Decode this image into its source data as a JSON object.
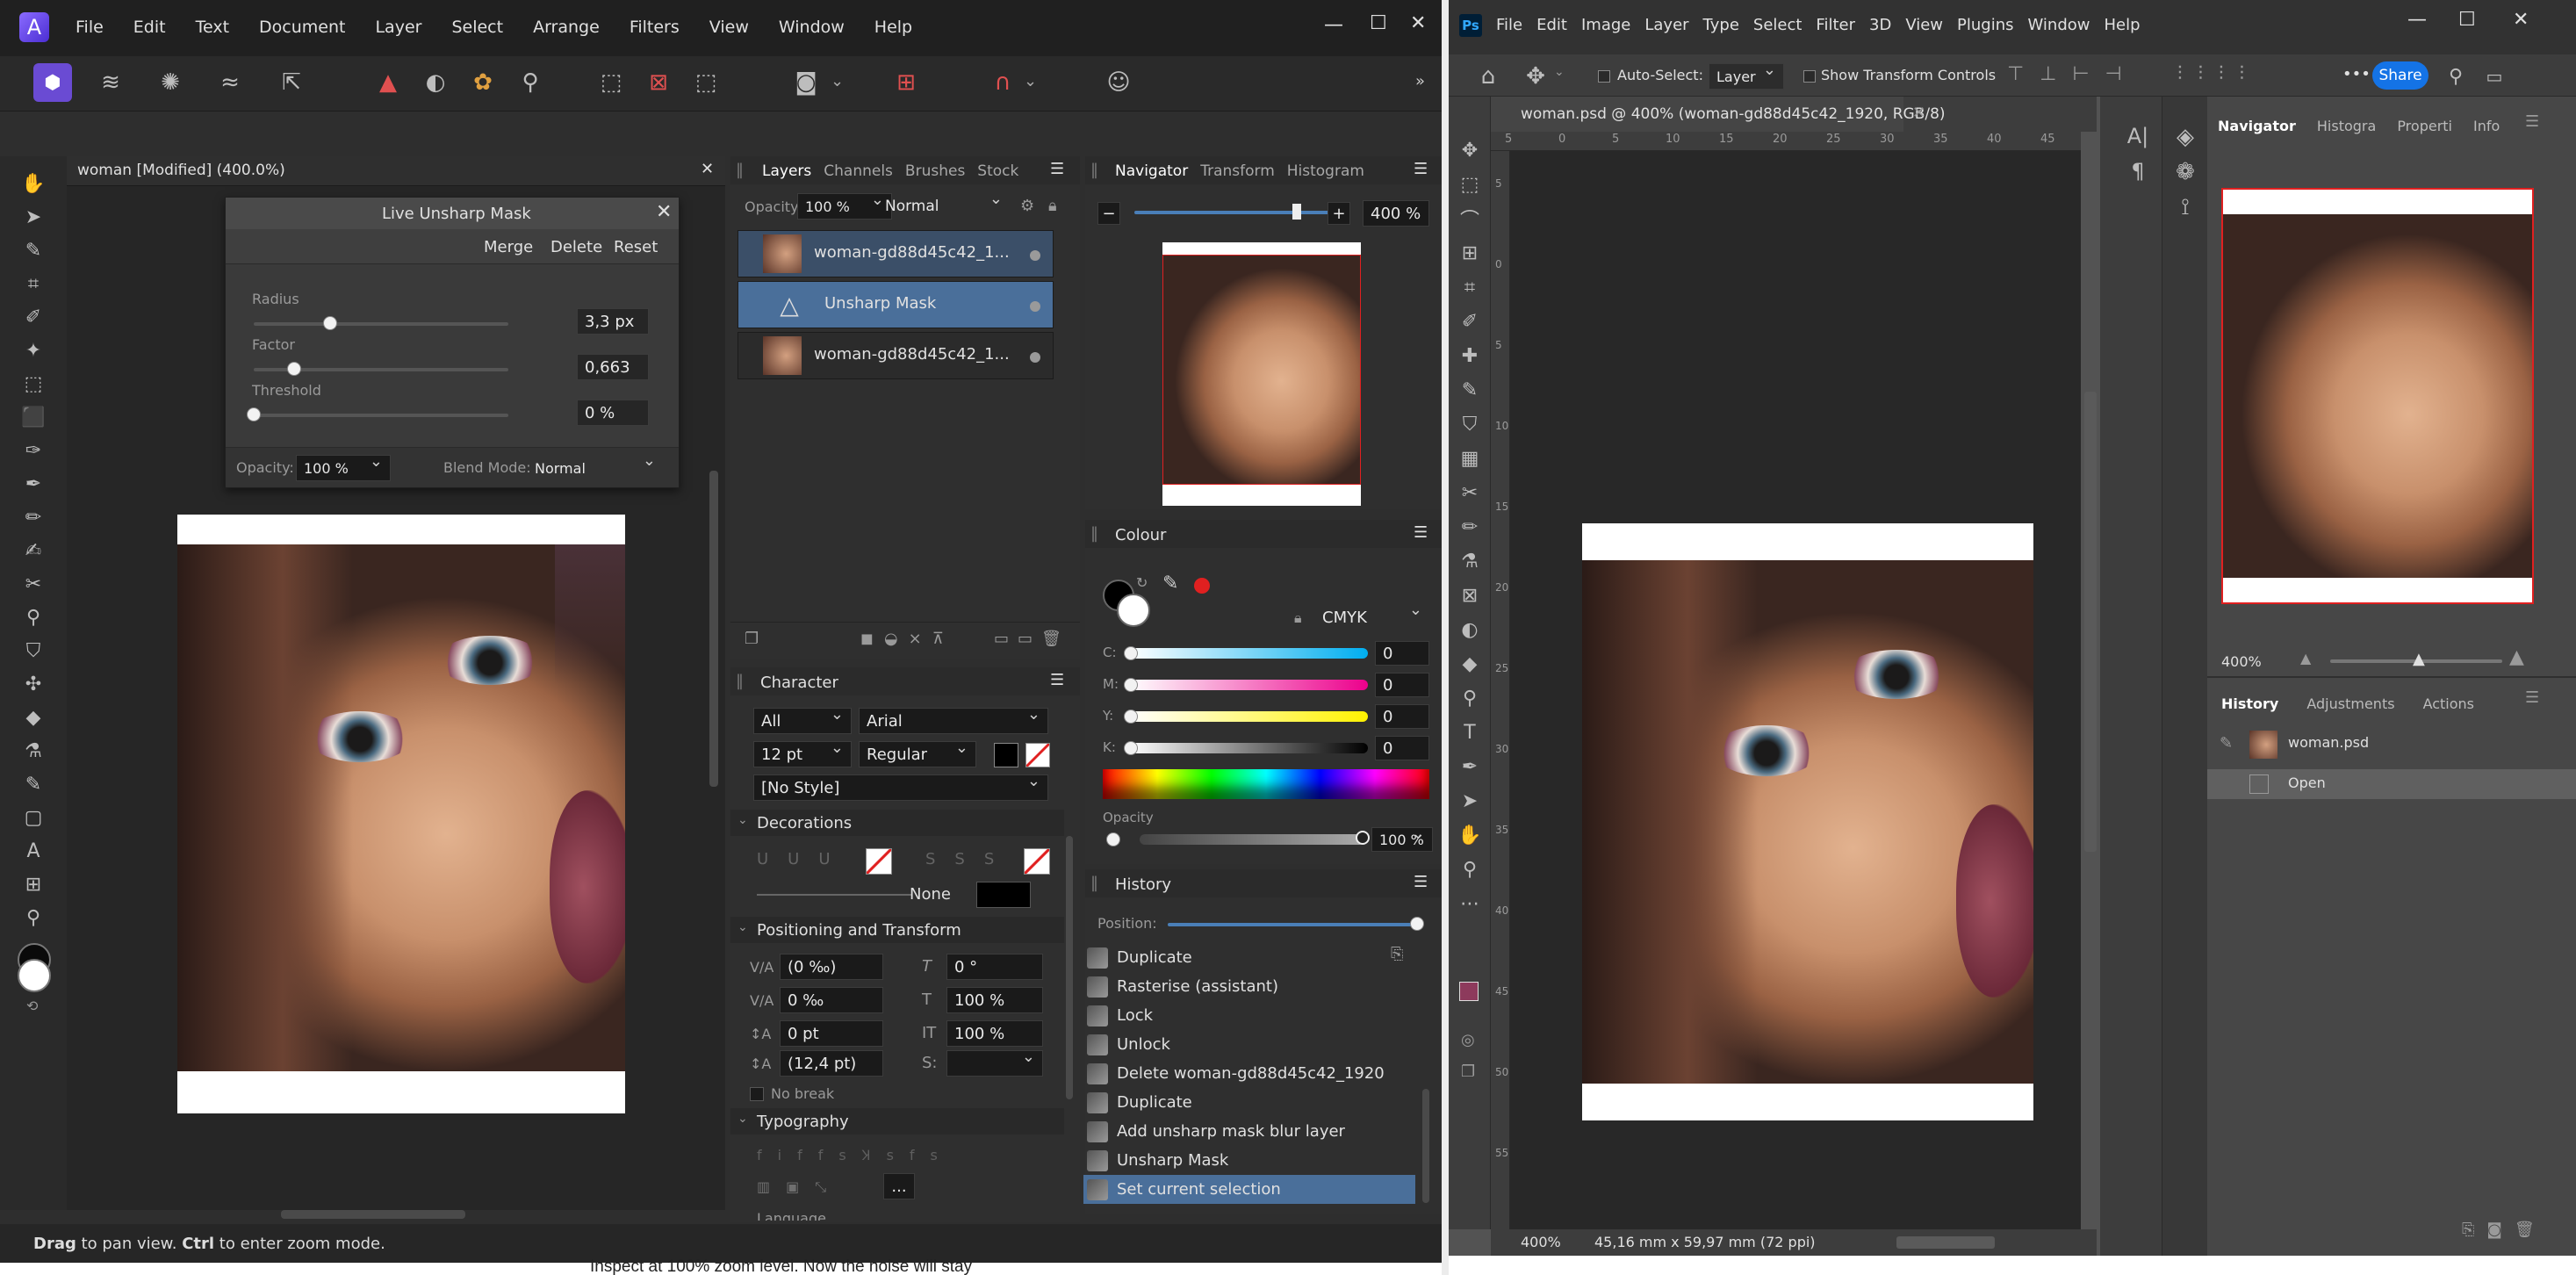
{
  "affinity": {
    "menu": [
      "File",
      "Edit",
      "Text",
      "Document",
      "Layer",
      "Select",
      "Arrange",
      "Filters",
      "View",
      "Window",
      "Help"
    ],
    "window_controls": {
      "minimize": "—",
      "maximize": "☐",
      "close": "✕"
    },
    "doc_tab": "woman [Modified] (400.0%)",
    "unsharp": {
      "title": "Live Unsharp Mask",
      "merge": "Merge",
      "delete": "Delete",
      "reset": "Reset",
      "radius_label": "Radius",
      "radius_value": "3,3 px",
      "radius_pos": 0.3,
      "factor_label": "Factor",
      "factor_value": "0,663",
      "factor_pos": 0.16,
      "threshold_label": "Threshold",
      "threshold_value": "0 %",
      "threshold_pos": 0.0,
      "opacity_label": "Opacity:",
      "opacity_value": "100 %",
      "blend_label": "Blend Mode:",
      "blend_value": "Normal"
    },
    "layers_panel": {
      "tabs": [
        "Layers",
        "Channels",
        "Brushes",
        "Stock"
      ],
      "opacity_label": "Opacity:",
      "opacity_value": "100 %",
      "blend": "Normal",
      "layers": [
        {
          "name": "woman-gd88d45c42_1..."
        },
        {
          "name": "Unsharp Mask"
        },
        {
          "name": "woman-gd88d45c42_1..."
        }
      ]
    },
    "navigator_panel": {
      "tabs": [
        "Navigator",
        "Transform",
        "Histogram"
      ],
      "zoom": "400 %",
      "zoom_minus": "−",
      "zoom_plus": "+"
    },
    "colour_panel": {
      "title": "Colour",
      "model": "CMYK",
      "c_label": "C:",
      "c": "0",
      "m_label": "M:",
      "m": "0",
      "y_label": "Y:",
      "y": "0",
      "k_label": "K:",
      "k": "0",
      "opacity_label": "Opacity",
      "opacity_value": "100 %"
    },
    "character_panel": {
      "title": "Character",
      "scope": "All",
      "font": "Arial",
      "size": "12 pt",
      "style": "Regular",
      "paragraph_style": "[No Style]",
      "decorations": "Decorations",
      "line_none": "None",
      "positioning": "Positioning and Transform",
      "tracking": "(0 ‰)",
      "shear": "0 °",
      "kerning": "0 ‰",
      "scale_h": "100 %",
      "baseline": "0 pt",
      "scale_v": "100 %",
      "leading": "(12,4 pt)",
      "no_break": "No break",
      "typography": "Typography",
      "language": "Language",
      "more": "..."
    },
    "history_panel": {
      "title": "History",
      "position_label": "Position:",
      "items": [
        "Duplicate",
        "Rasterise (assistant)",
        "Lock",
        "Unlock",
        "Delete woman-gd88d45c42_1920",
        "Duplicate",
        "Add unsharp mask blur layer",
        "Unsharp Mask",
        "Set current selection"
      ]
    },
    "status": {
      "bold1": "Drag",
      "text1": " to pan view. ",
      "bold2": "Ctrl",
      "text2": " to enter zoom mode."
    }
  },
  "photoshop": {
    "logo": "Ps",
    "menu": [
      "File",
      "Edit",
      "Image",
      "Layer",
      "Type",
      "Select",
      "Filter",
      "3D",
      "View",
      "Plugins",
      "Window",
      "Help"
    ],
    "options": {
      "auto_select": "Auto-Select:",
      "layer": "Layer",
      "show_transform": "Show Transform Controls",
      "more": "•••",
      "share": "Share"
    },
    "doc_tab": "woman.psd @ 400% (woman-gd88d45c42_1920, RGB/8)",
    "ruler_ticks": [
      "5",
      "0",
      "5",
      "10",
      "15",
      "20",
      "25",
      "30",
      "35",
      "40",
      "45"
    ],
    "ruler_v_ticks": [
      "5",
      "0",
      "5",
      "10",
      "15",
      "20",
      "25",
      "30",
      "35",
      "40",
      "45",
      "50",
      "55"
    ],
    "panel_tabs": [
      "Navigator",
      "Histogra",
      "Properti",
      "Info"
    ],
    "nav_zoom": "400%",
    "history_tabs": [
      "History",
      "Adjustments",
      "Actions"
    ],
    "history_items": [
      "woman.psd",
      "Open"
    ],
    "status": {
      "zoom": "400%",
      "info": "45,16 mm x 59,97 mm (72 ppi)"
    }
  },
  "background_text": "Inspect at 100% zoom level. Now the noise will stay",
  "colors": {
    "accent_blue": "#4a6f9a",
    "ps_blue": "#1473e6",
    "red": "#e02020",
    "pink": "#8d3a5c"
  }
}
